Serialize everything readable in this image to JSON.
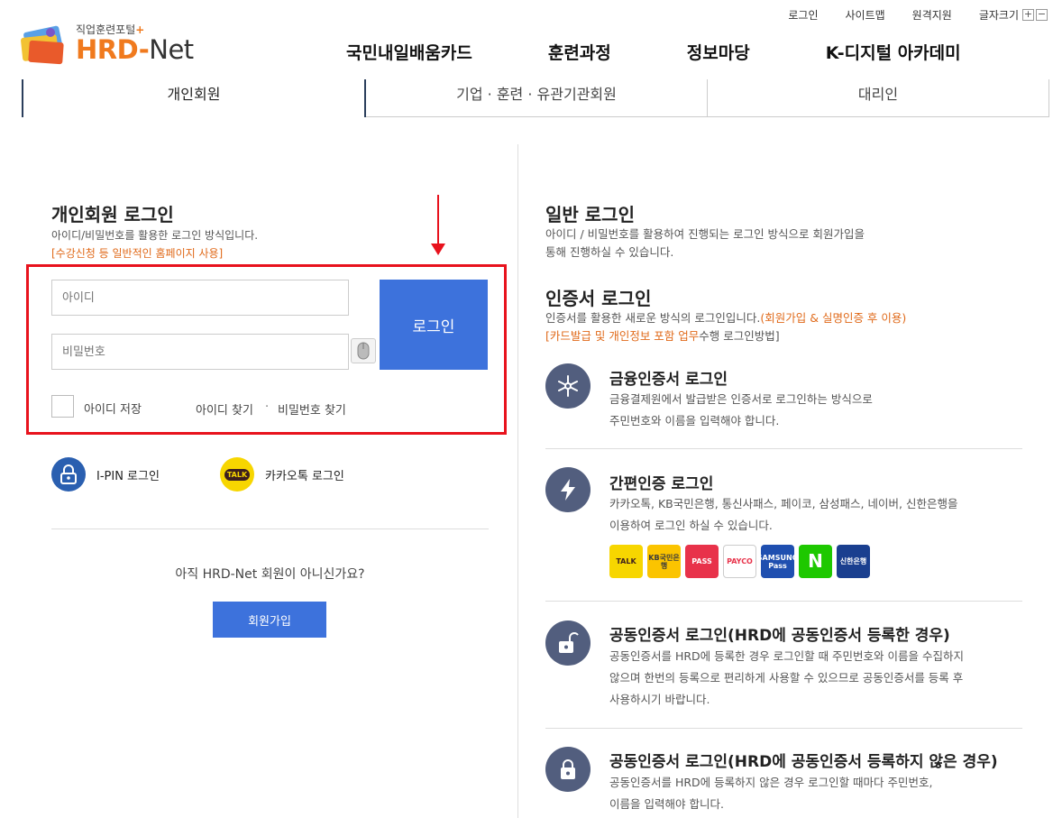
{
  "util": {
    "login": "로그인",
    "sitemap": "사이트맵",
    "remote": "원격지원",
    "fontsize": "글자크기",
    "plus": "+",
    "minus": "−"
  },
  "logo": {
    "tagline": "직업훈련포털",
    "tagline_mark": "+",
    "hrd": "HRD",
    "dash": "-",
    "net": "Net"
  },
  "gnb": [
    "국민내일배움카드",
    "훈련과정",
    "정보마당",
    "K-디지털 아카데미"
  ],
  "tabs": [
    "개인회원",
    "기업 · 훈련 · 유관기관회원",
    "대리인"
  ],
  "left": {
    "title": "개인회원 로그인",
    "desc": "아이디/비밀번호를 활용한 로그인 방식입니다.",
    "note": "[수강신청 등 일반적인 홈페이지 사용]",
    "id_placeholder": "아이디",
    "pw_placeholder": "비밀번호",
    "login_button": "로그인",
    "save_id": "아이디 저장",
    "find_id": "아이디 찾기",
    "sep": "·",
    "find_pw": "비밀번호 찾기",
    "ipin": "I-PIN 로그인",
    "kakao_icon_text": "TALK",
    "kakao": "카카오톡 로그인",
    "not_member": "아직 HRD-Net 회원이 아니신가요?",
    "join_button": "회원가입"
  },
  "right": {
    "general_title": "일반 로그인",
    "general_desc1": "아이디 / 비밀번호를 활용하여 진행되는 로그인 방식으로 회원가입을",
    "general_desc2": "통해 진행하실 수 있습니다.",
    "cert_title": "인증서 로그인",
    "cert_desc_a": "인증서를 활용한 새로운 방식의 로그인입니다.",
    "cert_desc_b": "(회원가입 & 실명인증 후 이용)",
    "cert_desc_c": "[카드발급 및 개인정보 포함 업무",
    "cert_desc_d": "수행 로그인방법]",
    "methods": [
      {
        "title": "금융인증서 로그인",
        "desc1": "금융결제원에서 발급받은 인증서로 로그인하는 방식으로",
        "desc2": "주민번호와 이름을 입력해야 합니다."
      },
      {
        "title": "간편인증 로그인",
        "desc1": "카카오톡, KB국민은행, 통신사패스, 페이코, 삼성패스, 네이버, 신한은행을",
        "desc2": "이용하여 로그인 하실 수 있습니다."
      },
      {
        "title": "공동인증서 로그인(HRD에 공동인증서 등록한 경우)",
        "desc1": "공동인증서를 HRD에 등록한 경우 로그인할 때 주민번호와 이름을 수집하지",
        "desc2": "않으며 한번의 등록으로 편리하게 사용할 수 있으므로 공동인증서를 등록 후",
        "desc3": "사용하시기 바랍니다."
      },
      {
        "title": "공동인증서 로그인(HRD에 공동인증서 등록하지 않은 경우)",
        "desc1": "공동인증서를 HRD에 등록하지 않은 경우 로그인할 때마다 주민번호,",
        "desc2": "이름을 입력해야 합니다."
      }
    ],
    "providers": [
      {
        "name": "TALK",
        "bg": "#f7d600",
        "fg": "#3c1e1e"
      },
      {
        "name": "KB국민은행",
        "bg": "#fbc400",
        "fg": "#3b3b3b"
      },
      {
        "name": "PASS",
        "bg": "#e8324a",
        "fg": "#ffffff"
      },
      {
        "name": "PAYCO",
        "bg": "#ffffff",
        "fg": "#e8324a"
      },
      {
        "name": "SAMSUNG Pass",
        "bg": "#1f4fb0",
        "fg": "#ffffff"
      },
      {
        "name": "N",
        "bg": "#1ec800",
        "fg": "#ffffff"
      },
      {
        "name": "신한은행",
        "bg": "#1a3f8f",
        "fg": "#ffffff"
      }
    ]
  },
  "colors": {
    "primary": "#3d72dc",
    "accent_orange": "#e06a1a",
    "highlight_red": "#e8121d",
    "icon_bg": "#525e7e"
  }
}
